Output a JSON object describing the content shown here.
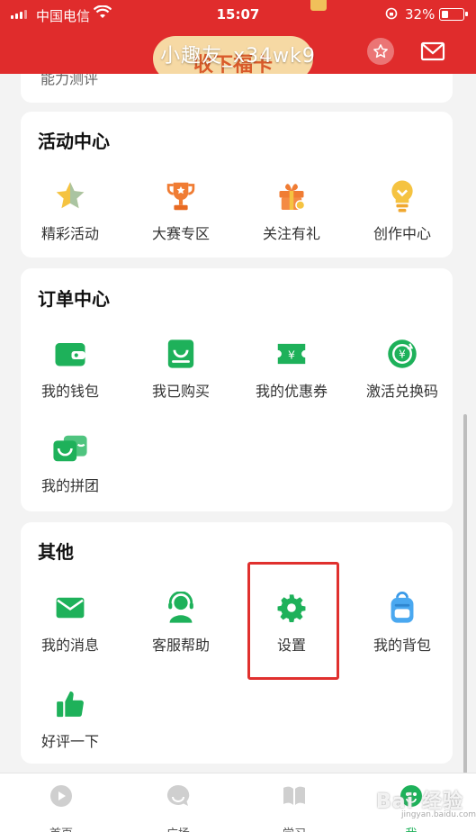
{
  "status_bar": {
    "carrier": "中国电信",
    "time": "15:07",
    "battery": "32%"
  },
  "header": {
    "banner_text": "收下福卡",
    "username": "小趣友_x34wk9"
  },
  "remnant_label": "能力测评",
  "sections": {
    "activity": {
      "title": "活动中心",
      "items": [
        {
          "label": "精彩活动",
          "icon": "star-icon"
        },
        {
          "label": "大赛专区",
          "icon": "trophy-icon"
        },
        {
          "label": "关注有礼",
          "icon": "gift-icon"
        },
        {
          "label": "创作中心",
          "icon": "lightbulb-icon"
        }
      ]
    },
    "orders": {
      "title": "订单中心",
      "items": [
        {
          "label": "我的钱包",
          "icon": "wallet-icon"
        },
        {
          "label": "我已购买",
          "icon": "shopping-bag-icon"
        },
        {
          "label": "我的优惠券",
          "icon": "coupon-icon"
        },
        {
          "label": "激活兑换码",
          "icon": "exchange-icon"
        },
        {
          "label": "我的拼团",
          "icon": "group-buy-icon"
        }
      ]
    },
    "other": {
      "title": "其他",
      "items": [
        {
          "label": "我的消息",
          "icon": "mail-icon"
        },
        {
          "label": "客服帮助",
          "icon": "headset-icon"
        },
        {
          "label": "设置",
          "icon": "gear-icon"
        },
        {
          "label": "我的背包",
          "icon": "backpack-icon"
        },
        {
          "label": "好评一下",
          "icon": "thumbs-up-icon"
        }
      ]
    }
  },
  "tabbar": [
    {
      "label": "首页",
      "icon": "home-play-icon",
      "active": false
    },
    {
      "label": "广场",
      "icon": "square-chat-icon",
      "active": false
    },
    {
      "label": "学习",
      "icon": "book-icon",
      "active": false
    },
    {
      "label": "我",
      "icon": "me-icon",
      "active": true
    }
  ],
  "watermark": {
    "text": "Bai 经验",
    "sub": "jingyan.baidu.com"
  },
  "colors": {
    "accent_green": "#1eb15a",
    "header_red": "#e02c2c",
    "icon_orange": "#f07c33",
    "icon_gold": "#f5c341",
    "highlight_red": "#e0302e"
  }
}
